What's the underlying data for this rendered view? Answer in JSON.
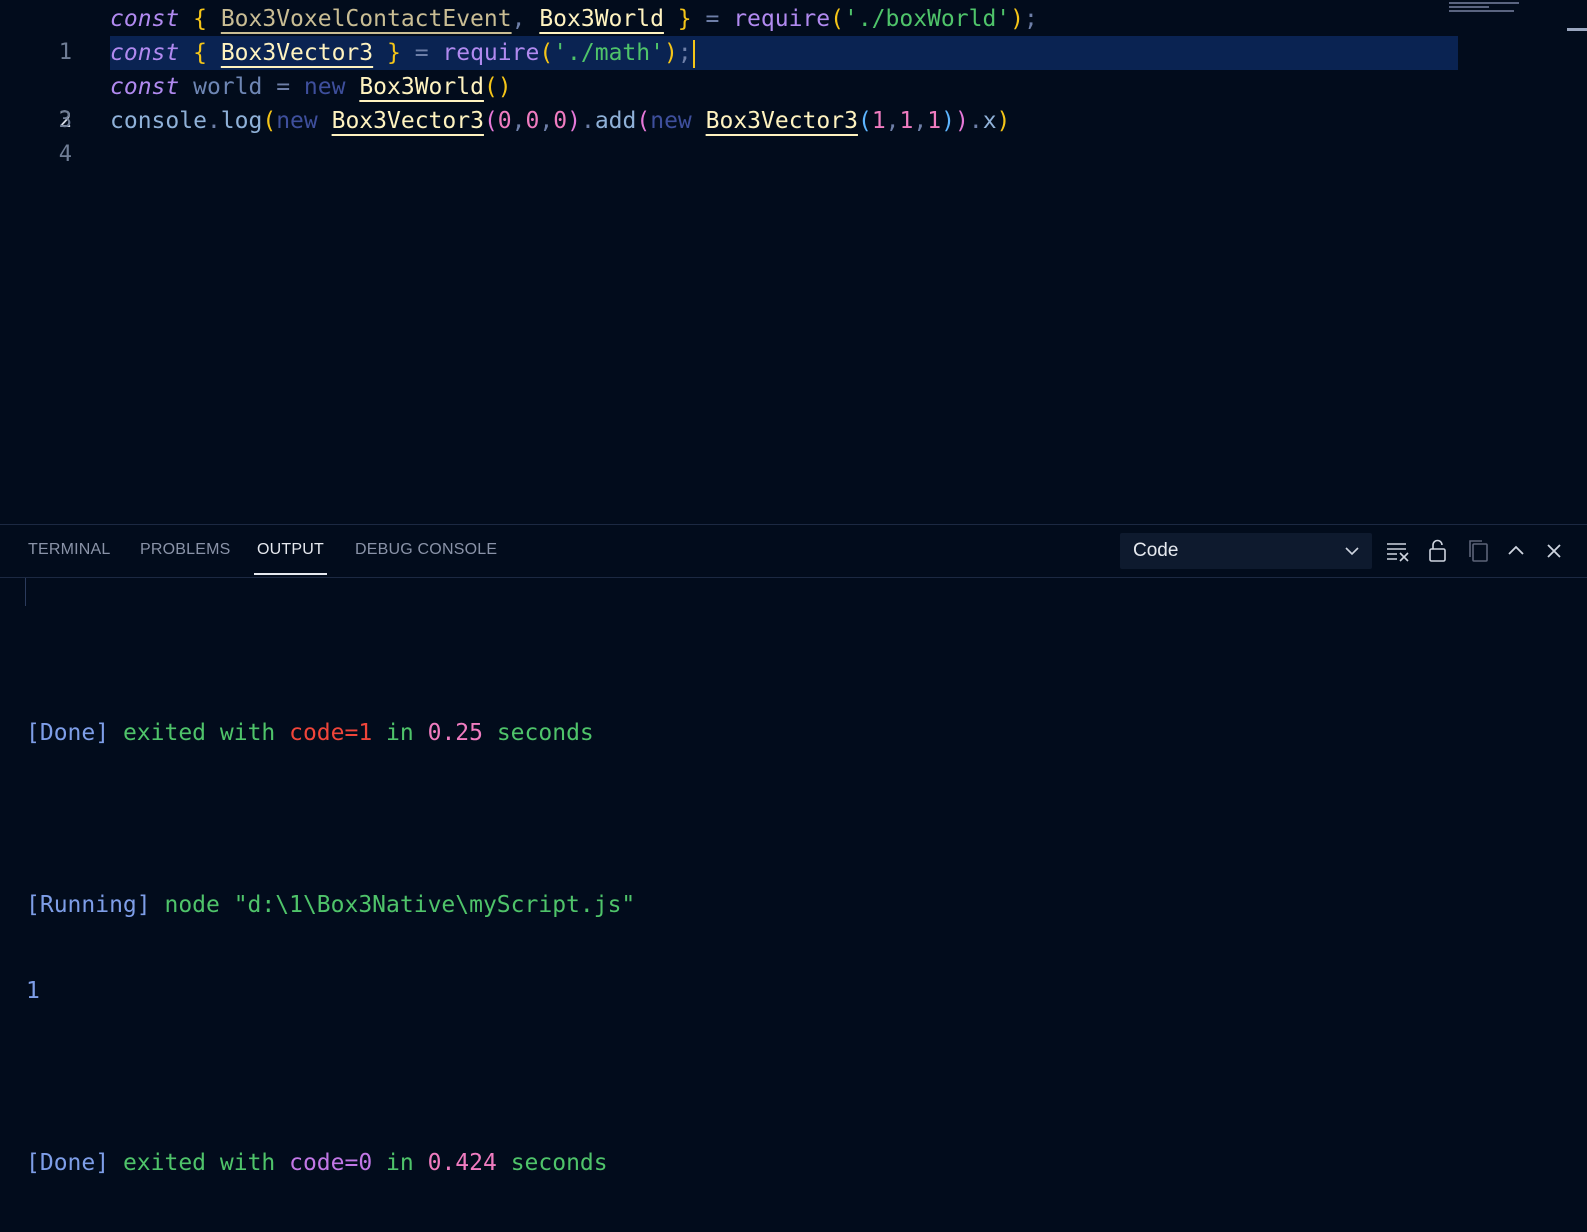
{
  "editor": {
    "lines": [
      {
        "no": "1"
      },
      {
        "no": "2"
      },
      {
        "no": "3"
      },
      {
        "no": "4"
      }
    ],
    "tokens": {
      "const": "const",
      "lbrace": "{ ",
      "rbrace": " }",
      "box3voxelcontactevent": "Box3VoxelContactEvent",
      "comma": ", ",
      "box3world": "Box3World",
      "box3vector3": "Box3Vector3",
      "eq": " = ",
      "require": "require",
      "lparen": "(",
      "rparen": ")",
      "str_boxworld": "'./boxWorld'",
      "str_math": "'./math'",
      "semi": ";",
      "world": "world",
      "new": "new",
      "empty_parens": "()",
      "console": "console",
      "dot": ".",
      "log": "log",
      "zero": "0",
      "one": "1",
      "comma_tight": ",",
      "add": "add",
      "x": "x"
    }
  },
  "panel": {
    "tabs": [
      "TERMINAL",
      "PROBLEMS",
      "OUTPUT",
      "DEBUG CONSOLE"
    ],
    "active_tab": "OUTPUT",
    "output_channel": "Code",
    "output": {
      "done1": {
        "bracket": "[Done]",
        "exited": " exited with ",
        "code": "code=1",
        "in": " in ",
        "time": "0.25",
        "seconds": " seconds"
      },
      "running": {
        "bracket": "[Running]",
        "cmd": " node \"d:\\1\\Box3Native\\myScript.js\""
      },
      "result": "1",
      "done2": {
        "bracket": "[Done]",
        "exited": " exited with ",
        "code": "code=0",
        "in": " in ",
        "time": "0.424",
        "seconds": " seconds"
      }
    }
  },
  "colors": {
    "background": "#020c1c",
    "active_line": "#0a2352",
    "cursor": "#f5c518",
    "error_code": "#f0453a",
    "ok_code": "#c277e6"
  },
  "icons": [
    "clear-output-icon",
    "lock-icon",
    "copy-icon",
    "maximize-panel-icon",
    "close-panel-icon",
    "chevron-down-icon"
  ]
}
